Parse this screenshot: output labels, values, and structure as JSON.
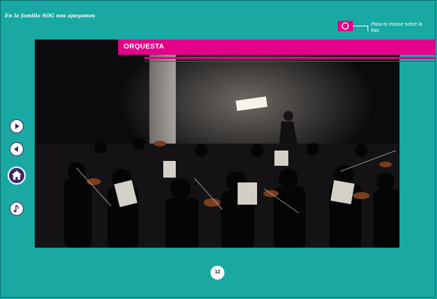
{
  "header": {
    "title": "En la familia SOG nos apoyamos"
  },
  "hint": {
    "text": "Pasa tu mouse sobre la foto",
    "icon": "camera-icon"
  },
  "banner": {
    "label": "ORQUESTA"
  },
  "photo": {
    "subject": "orchestra",
    "icon": "orchestra-photo"
  },
  "nav": {
    "next_icon": "play-right-icon",
    "prev_icon": "play-left-icon",
    "home_icon": "home-icon",
    "music_icon": "music-note-icon"
  },
  "footer": {
    "page_number": "12"
  },
  "colors": {
    "background": "#1aa8a3",
    "accent": "#e4008a",
    "nav": "#3c2a6e"
  }
}
